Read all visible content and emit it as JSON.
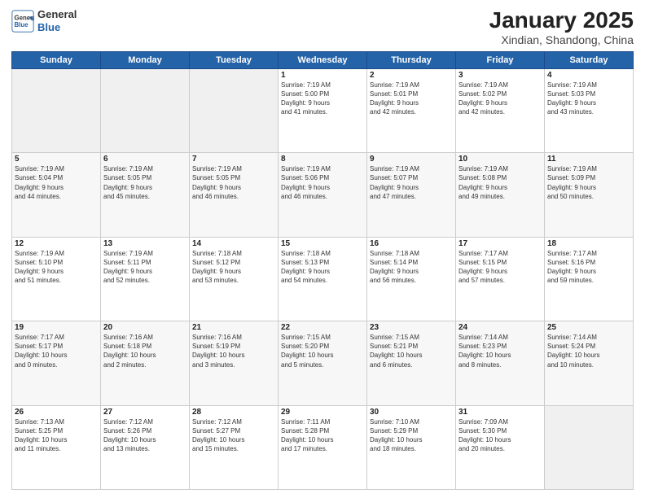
{
  "header": {
    "logo_line1": "General",
    "logo_line2": "Blue",
    "title": "January 2025",
    "subtitle": "Xindian, Shandong, China"
  },
  "days_of_week": [
    "Sunday",
    "Monday",
    "Tuesday",
    "Wednesday",
    "Thursday",
    "Friday",
    "Saturday"
  ],
  "weeks": [
    [
      {
        "day": "",
        "content": ""
      },
      {
        "day": "",
        "content": ""
      },
      {
        "day": "",
        "content": ""
      },
      {
        "day": "1",
        "content": "Sunrise: 7:19 AM\nSunset: 5:00 PM\nDaylight: 9 hours\nand 41 minutes."
      },
      {
        "day": "2",
        "content": "Sunrise: 7:19 AM\nSunset: 5:01 PM\nDaylight: 9 hours\nand 42 minutes."
      },
      {
        "day": "3",
        "content": "Sunrise: 7:19 AM\nSunset: 5:02 PM\nDaylight: 9 hours\nand 42 minutes."
      },
      {
        "day": "4",
        "content": "Sunrise: 7:19 AM\nSunset: 5:03 PM\nDaylight: 9 hours\nand 43 minutes."
      }
    ],
    [
      {
        "day": "5",
        "content": "Sunrise: 7:19 AM\nSunset: 5:04 PM\nDaylight: 9 hours\nand 44 minutes."
      },
      {
        "day": "6",
        "content": "Sunrise: 7:19 AM\nSunset: 5:05 PM\nDaylight: 9 hours\nand 45 minutes."
      },
      {
        "day": "7",
        "content": "Sunrise: 7:19 AM\nSunset: 5:05 PM\nDaylight: 9 hours\nand 46 minutes."
      },
      {
        "day": "8",
        "content": "Sunrise: 7:19 AM\nSunset: 5:06 PM\nDaylight: 9 hours\nand 46 minutes."
      },
      {
        "day": "9",
        "content": "Sunrise: 7:19 AM\nSunset: 5:07 PM\nDaylight: 9 hours\nand 47 minutes."
      },
      {
        "day": "10",
        "content": "Sunrise: 7:19 AM\nSunset: 5:08 PM\nDaylight: 9 hours\nand 49 minutes."
      },
      {
        "day": "11",
        "content": "Sunrise: 7:19 AM\nSunset: 5:09 PM\nDaylight: 9 hours\nand 50 minutes."
      }
    ],
    [
      {
        "day": "12",
        "content": "Sunrise: 7:19 AM\nSunset: 5:10 PM\nDaylight: 9 hours\nand 51 minutes."
      },
      {
        "day": "13",
        "content": "Sunrise: 7:19 AM\nSunset: 5:11 PM\nDaylight: 9 hours\nand 52 minutes."
      },
      {
        "day": "14",
        "content": "Sunrise: 7:18 AM\nSunset: 5:12 PM\nDaylight: 9 hours\nand 53 minutes."
      },
      {
        "day": "15",
        "content": "Sunrise: 7:18 AM\nSunset: 5:13 PM\nDaylight: 9 hours\nand 54 minutes."
      },
      {
        "day": "16",
        "content": "Sunrise: 7:18 AM\nSunset: 5:14 PM\nDaylight: 9 hours\nand 56 minutes."
      },
      {
        "day": "17",
        "content": "Sunrise: 7:17 AM\nSunset: 5:15 PM\nDaylight: 9 hours\nand 57 minutes."
      },
      {
        "day": "18",
        "content": "Sunrise: 7:17 AM\nSunset: 5:16 PM\nDaylight: 9 hours\nand 59 minutes."
      }
    ],
    [
      {
        "day": "19",
        "content": "Sunrise: 7:17 AM\nSunset: 5:17 PM\nDaylight: 10 hours\nand 0 minutes."
      },
      {
        "day": "20",
        "content": "Sunrise: 7:16 AM\nSunset: 5:18 PM\nDaylight: 10 hours\nand 2 minutes."
      },
      {
        "day": "21",
        "content": "Sunrise: 7:16 AM\nSunset: 5:19 PM\nDaylight: 10 hours\nand 3 minutes."
      },
      {
        "day": "22",
        "content": "Sunrise: 7:15 AM\nSunset: 5:20 PM\nDaylight: 10 hours\nand 5 minutes."
      },
      {
        "day": "23",
        "content": "Sunrise: 7:15 AM\nSunset: 5:21 PM\nDaylight: 10 hours\nand 6 minutes."
      },
      {
        "day": "24",
        "content": "Sunrise: 7:14 AM\nSunset: 5:23 PM\nDaylight: 10 hours\nand 8 minutes."
      },
      {
        "day": "25",
        "content": "Sunrise: 7:14 AM\nSunset: 5:24 PM\nDaylight: 10 hours\nand 10 minutes."
      }
    ],
    [
      {
        "day": "26",
        "content": "Sunrise: 7:13 AM\nSunset: 5:25 PM\nDaylight: 10 hours\nand 11 minutes."
      },
      {
        "day": "27",
        "content": "Sunrise: 7:12 AM\nSunset: 5:26 PM\nDaylight: 10 hours\nand 13 minutes."
      },
      {
        "day": "28",
        "content": "Sunrise: 7:12 AM\nSunset: 5:27 PM\nDaylight: 10 hours\nand 15 minutes."
      },
      {
        "day": "29",
        "content": "Sunrise: 7:11 AM\nSunset: 5:28 PM\nDaylight: 10 hours\nand 17 minutes."
      },
      {
        "day": "30",
        "content": "Sunrise: 7:10 AM\nSunset: 5:29 PM\nDaylight: 10 hours\nand 18 minutes."
      },
      {
        "day": "31",
        "content": "Sunrise: 7:09 AM\nSunset: 5:30 PM\nDaylight: 10 hours\nand 20 minutes."
      },
      {
        "day": "",
        "content": ""
      }
    ]
  ]
}
